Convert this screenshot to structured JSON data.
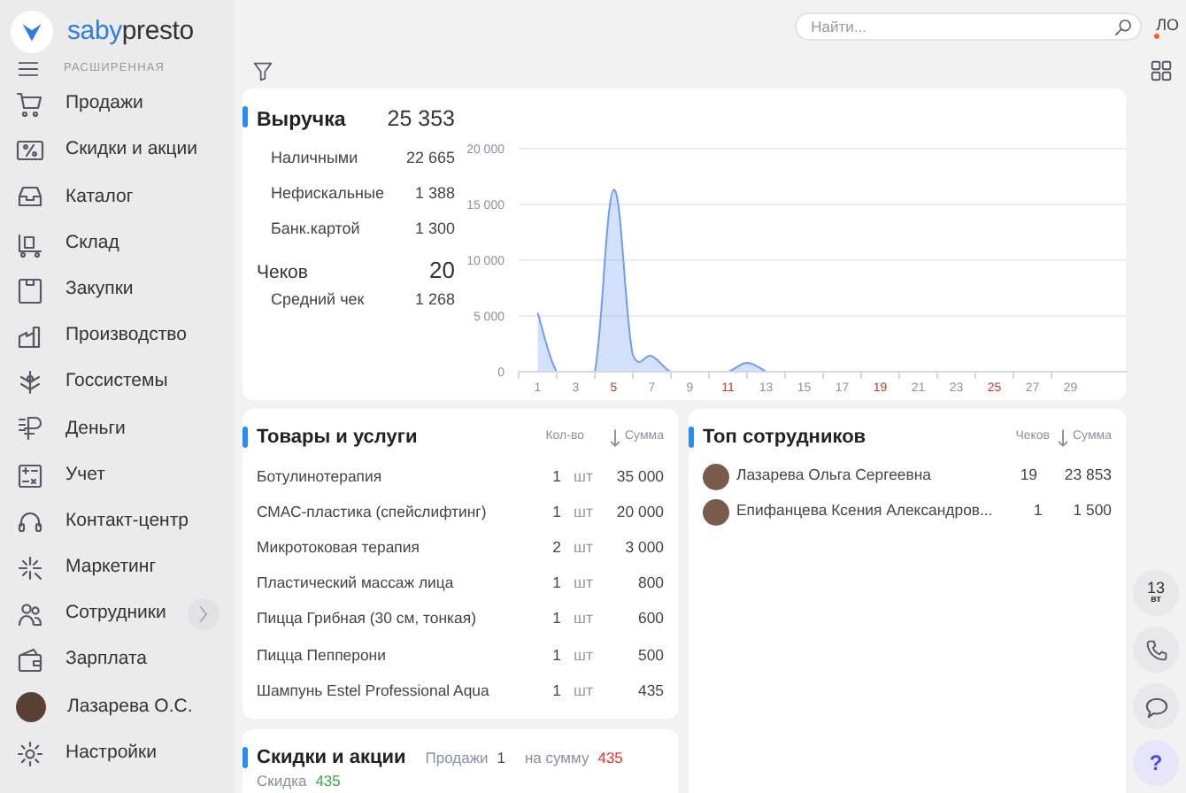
{
  "logo": {
    "brand": "saby",
    "product": "presto"
  },
  "sidebar": {
    "mode_label": "РАСШИРЕННАЯ",
    "items": [
      {
        "label": "Продажи",
        "kind": "icon",
        "has_submenu": false
      },
      {
        "label": "Скидки и акции",
        "kind": "icon",
        "has_submenu": false
      },
      {
        "label": "Каталог",
        "kind": "icon",
        "has_submenu": false
      },
      {
        "label": "Склад",
        "kind": "icon",
        "has_submenu": false
      },
      {
        "label": "Закупки",
        "kind": "icon",
        "has_submenu": false
      },
      {
        "label": "Производство",
        "kind": "icon",
        "has_submenu": false
      },
      {
        "label": "Госсистемы",
        "kind": "icon",
        "has_submenu": false
      },
      {
        "label": "Деньги",
        "kind": "icon",
        "has_submenu": false
      },
      {
        "label": "Учет",
        "kind": "icon",
        "has_submenu": false
      },
      {
        "label": "Контакт-центр",
        "kind": "icon",
        "has_submenu": false
      },
      {
        "label": "Маркетинг",
        "kind": "icon",
        "has_submenu": false
      },
      {
        "label": "Сотрудники",
        "kind": "icon",
        "has_submenu": true
      },
      {
        "label": "Зарплата",
        "kind": "icon",
        "has_submenu": false
      },
      {
        "label": "Лазарева О.С.",
        "kind": "avatar",
        "has_submenu": false
      },
      {
        "label": "Настройки",
        "kind": "icon",
        "has_submenu": false
      }
    ]
  },
  "search": {
    "placeholder": "Найти..."
  },
  "user_initials": "ЛО",
  "revenue": {
    "title": "Выручка",
    "total": "25 353",
    "rows": [
      {
        "label": "Наличными",
        "value": "22 665",
        "kind": "sub"
      },
      {
        "label": "Нефискальные",
        "value": "1 388",
        "kind": "sub"
      },
      {
        "label": "Банк.картой",
        "value": "1 300",
        "kind": "sub"
      },
      {
        "label": "Чеков",
        "value": "20",
        "kind": "main"
      },
      {
        "label": "Средний чек",
        "value": "1 268",
        "kind": "sub"
      }
    ],
    "xtick_highlighted": [
      false,
      false,
      true,
      false,
      false,
      true,
      false,
      false,
      false,
      true,
      false,
      false,
      true,
      false,
      false
    ],
    "chart_data": {
      "type": "area",
      "x": [
        1,
        2,
        3,
        4,
        5,
        6,
        7,
        8,
        9,
        10,
        11,
        12,
        13
      ],
      "series": [
        {
          "color": "#6f9cf5",
          "values": [
            5300,
            0,
            0,
            0,
            16300,
            1500,
            1400,
            0,
            0,
            0,
            0,
            800,
            0
          ]
        }
      ],
      "xlim": [
        0,
        32
      ],
      "ylim": [
        0,
        20000
      ],
      "grid": true,
      "yticks": [
        {
          "value": 0,
          "label": "0"
        },
        {
          "value": 5000,
          "label": "5 000"
        },
        {
          "value": 10000,
          "label": "10 000"
        },
        {
          "value": 15000,
          "label": "15 000"
        },
        {
          "value": 20000,
          "label": "20 000"
        }
      ],
      "xticks": [
        1,
        3,
        5,
        7,
        9,
        11,
        13,
        15,
        17,
        19,
        21,
        23,
        25,
        27,
        29
      ]
    }
  },
  "products": {
    "title": "Товары и услуги",
    "columns": [
      "Кол-во",
      "Сумма"
    ],
    "rows": [
      {
        "name": "Ботулинотерапия",
        "qty": "1",
        "unit": "шт",
        "sum": "35 000"
      },
      {
        "name": "СМАС-пластика (спейслифтинг)",
        "qty": "1",
        "unit": "шт",
        "sum": "20 000"
      },
      {
        "name": "Микротоковая терапия",
        "qty": "2",
        "unit": "шт",
        "sum": "3 000"
      },
      {
        "name": "Пластический массаж лица",
        "qty": "1",
        "unit": "шт",
        "sum": "800"
      },
      {
        "name": "Пицца Грибная (30 см, тонкая)",
        "qty": "1",
        "unit": "шт",
        "sum": "600"
      },
      {
        "name": "Пицца Пепперони",
        "qty": "1",
        "unit": "шт",
        "sum": "500"
      },
      {
        "name": "Шампунь Estel Professional Aqua",
        "qty": "1",
        "unit": "шт",
        "sum": "435"
      }
    ]
  },
  "discounts": {
    "title": "Скидки и акции",
    "sales_label": "Продажи",
    "sales_count": "1",
    "amount_label": "на сумму",
    "amount": "435",
    "discount_label": "Скидка",
    "discount": "435"
  },
  "employees": {
    "title": "Топ сотрудников",
    "columns": [
      "Чеков",
      "Сумма"
    ],
    "rows": [
      {
        "name": "Лазарева Ольга Сергеевна",
        "checks": "19",
        "sum": "23 853"
      },
      {
        "name": "Епифанцева Ксения Александров...",
        "checks": "1",
        "sum": "1 500"
      }
    ]
  },
  "right_rail": {
    "date_day": "13",
    "date_weekday": "вт",
    "help": "?"
  }
}
